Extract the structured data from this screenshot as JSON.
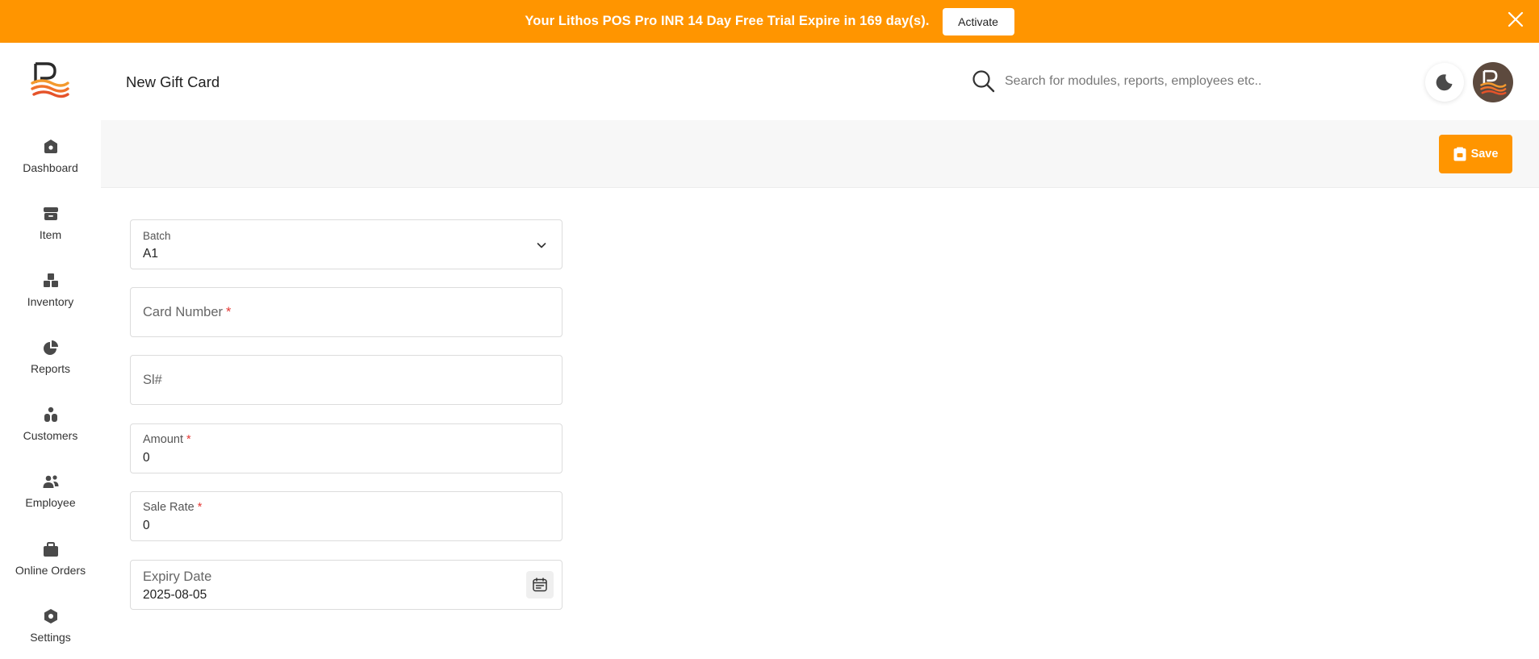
{
  "banner": {
    "message": "Your Lithos POS Pro INR 14 Day Free Trial Expire in 169 day(s).",
    "activate_label": "Activate",
    "background_color": "#ff9500"
  },
  "sidebar": {
    "logo_icon": "lithos-logo",
    "items": [
      {
        "label": "Dashboard",
        "icon": "dashboard-icon"
      },
      {
        "label": "Item",
        "icon": "archive-box-icon"
      },
      {
        "label": "Inventory",
        "icon": "boxes-icon"
      },
      {
        "label": "Reports",
        "icon": "pie-chart-icon"
      },
      {
        "label": "Customers",
        "icon": "customers-icon"
      },
      {
        "label": "Employee",
        "icon": "people-icon"
      },
      {
        "label": "Online Orders",
        "icon": "shopping-bag-icon"
      },
      {
        "label": "Settings",
        "icon": "settings-hex-icon"
      }
    ]
  },
  "header": {
    "title": "New Gift Card",
    "search_placeholder": "Search for modules, reports, employees etc.."
  },
  "toolbar": {
    "save_label": "Save"
  },
  "form": {
    "batch": {
      "label": "Batch",
      "value": "A1"
    },
    "card_number": {
      "label": "Card Number",
      "required_mark": "*"
    },
    "sl_no": {
      "label": "Sl#"
    },
    "amount": {
      "label": "Amount",
      "required_mark": "*",
      "value": "0"
    },
    "sale_rate": {
      "label": "Sale Rate",
      "required_mark": "*",
      "value": "0"
    },
    "expiry_date": {
      "label": "Expiry Date",
      "value": "2025-08-05"
    }
  },
  "colors": {
    "accent": "#ff9500",
    "required": "#e53935",
    "avatar_bg": "#5d4a3e"
  }
}
